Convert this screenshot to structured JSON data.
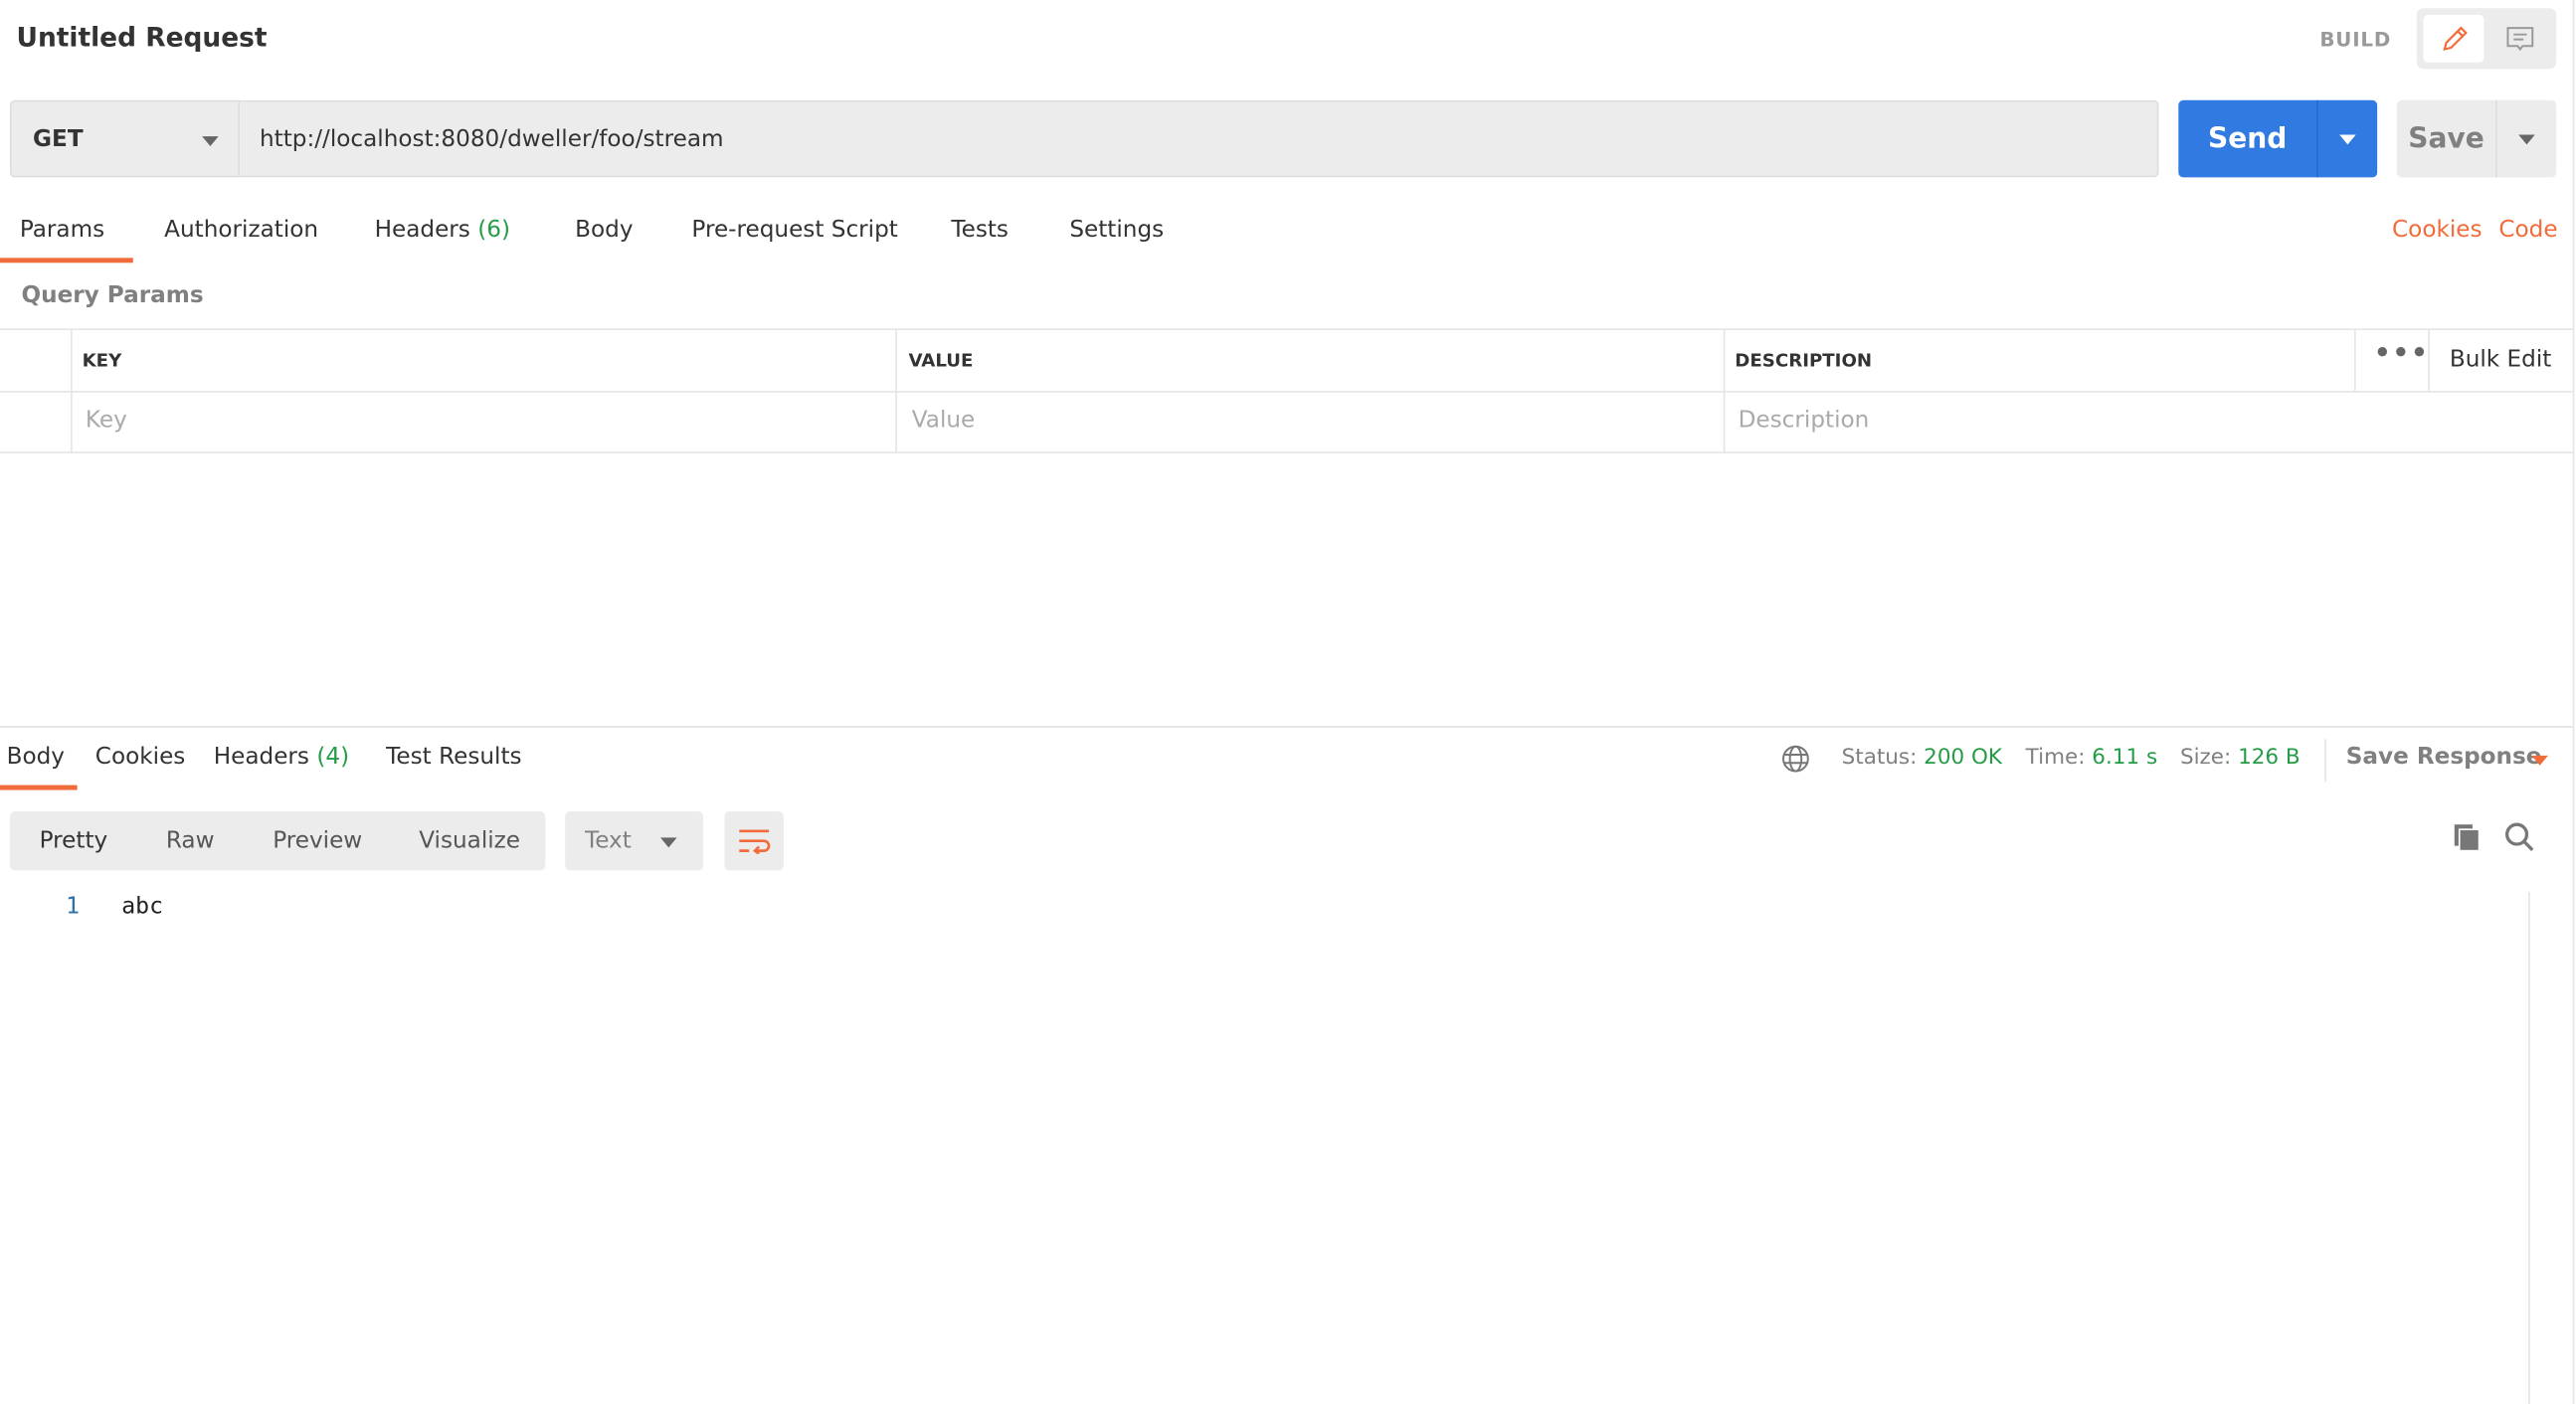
{
  "header": {
    "title": "Untitled Request",
    "mode": "BUILD",
    "mode_icons": [
      "pencil-icon",
      "comment-icon"
    ]
  },
  "request": {
    "method": "GET",
    "url": "http://localhost:8080/dweller/foo/stream",
    "send_label": "Send",
    "save_label": "Save"
  },
  "tabs": [
    {
      "label": "Params",
      "active": true
    },
    {
      "label": "Authorization"
    },
    {
      "label": "Headers",
      "count": "(6)"
    },
    {
      "label": "Body"
    },
    {
      "label": "Pre-request Script"
    },
    {
      "label": "Tests"
    },
    {
      "label": "Settings"
    }
  ],
  "links": {
    "cookies": "Cookies",
    "code": "Code"
  },
  "params": {
    "title": "Query Params",
    "columns": [
      "KEY",
      "VALUE",
      "DESCRIPTION"
    ],
    "bulk_edit": "Bulk Edit",
    "placeholders": {
      "key": "Key",
      "value": "Value",
      "description": "Description"
    }
  },
  "response": {
    "tabs": [
      {
        "label": "Body",
        "active": true
      },
      {
        "label": "Cookies"
      },
      {
        "label": "Headers",
        "count": "(4)"
      },
      {
        "label": "Test Results"
      }
    ],
    "status_label": "Status:",
    "status": "200 OK",
    "time_label": "Time:",
    "time": "6.11 s",
    "size_label": "Size:",
    "size": "126 B",
    "save_response": "Save Response",
    "views": [
      "Pretty",
      "Raw",
      "Preview",
      "Visualize"
    ],
    "active_view": "Pretty",
    "format": "Text",
    "lines": [
      {
        "num": "1",
        "text": "abc"
      }
    ]
  },
  "colors": {
    "accent": "#f26b3a",
    "send": "#317ae2",
    "success": "#259c47"
  }
}
